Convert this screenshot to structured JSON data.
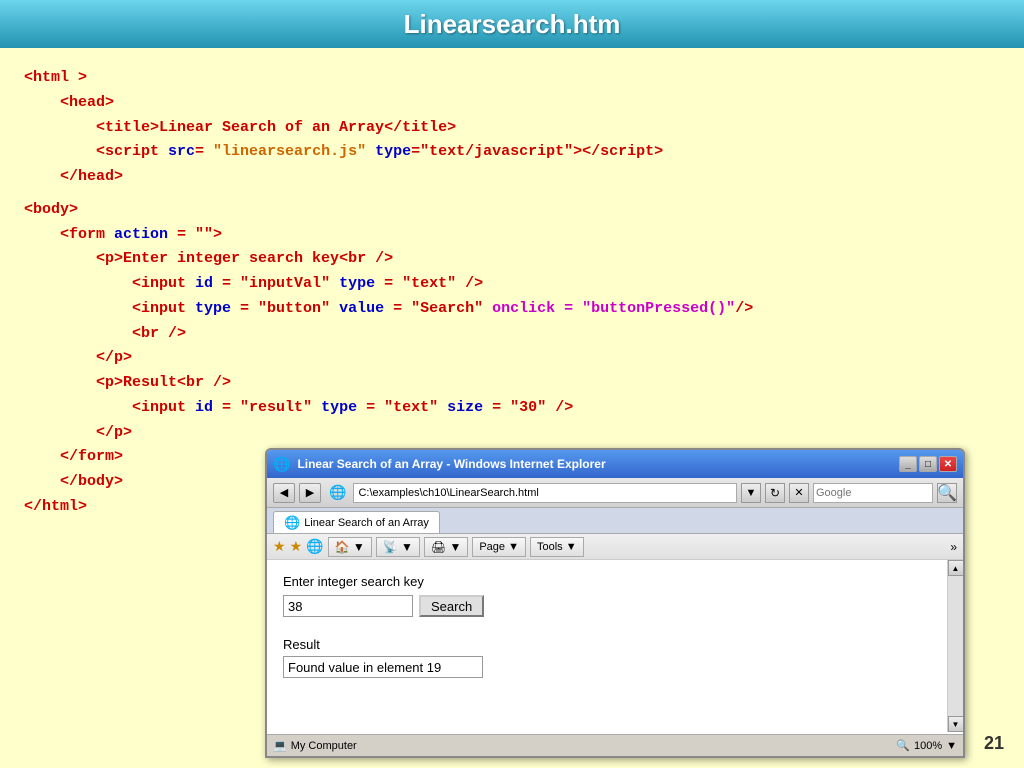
{
  "header": {
    "title": "Linearsearch.htm"
  },
  "code": {
    "line1": "<html >",
    "line2": "<head>",
    "line3": "<title>Linear Search of an Array</title>",
    "line4": "<script src= \"linearsearch.js\" type=\"text/javascript\"></script>",
    "line5": "</head>",
    "line6": "<body>",
    "line7": "<form action  = \"\">",
    "line8": "<p>Enter integer search key<br />",
    "line9": "<input id = \"inputVal\" type = \"text\" />",
    "line10": "<input type = \"button\" value = \"Search\"",
    "line11": "onclick = \"buttonPressed()\"/>",
    "line12": "<br />",
    "line13": "</p>",
    "line14": "<p>Result<br />",
    "line15": "<input id = \"result\" type = \"text\" size = \"30\" />",
    "line16": "</p>",
    "line17": "</form>",
    "line18": "</body>",
    "line19": "</html>"
  },
  "browser": {
    "title": "Linear Search of an Array - Windows Internet Explorer",
    "address": "C:\\examples\\ch10\\LinearSearch.html",
    "google_placeholder": "Google",
    "tab_label": "Linear Search of an Array",
    "form_label": "Enter integer search key",
    "input_value": "38",
    "search_btn": "Search",
    "result_label": "Result",
    "result_value": "Found value in element 19",
    "status_text": "My Computer",
    "zoom_text": "100%"
  },
  "page_number": "21"
}
